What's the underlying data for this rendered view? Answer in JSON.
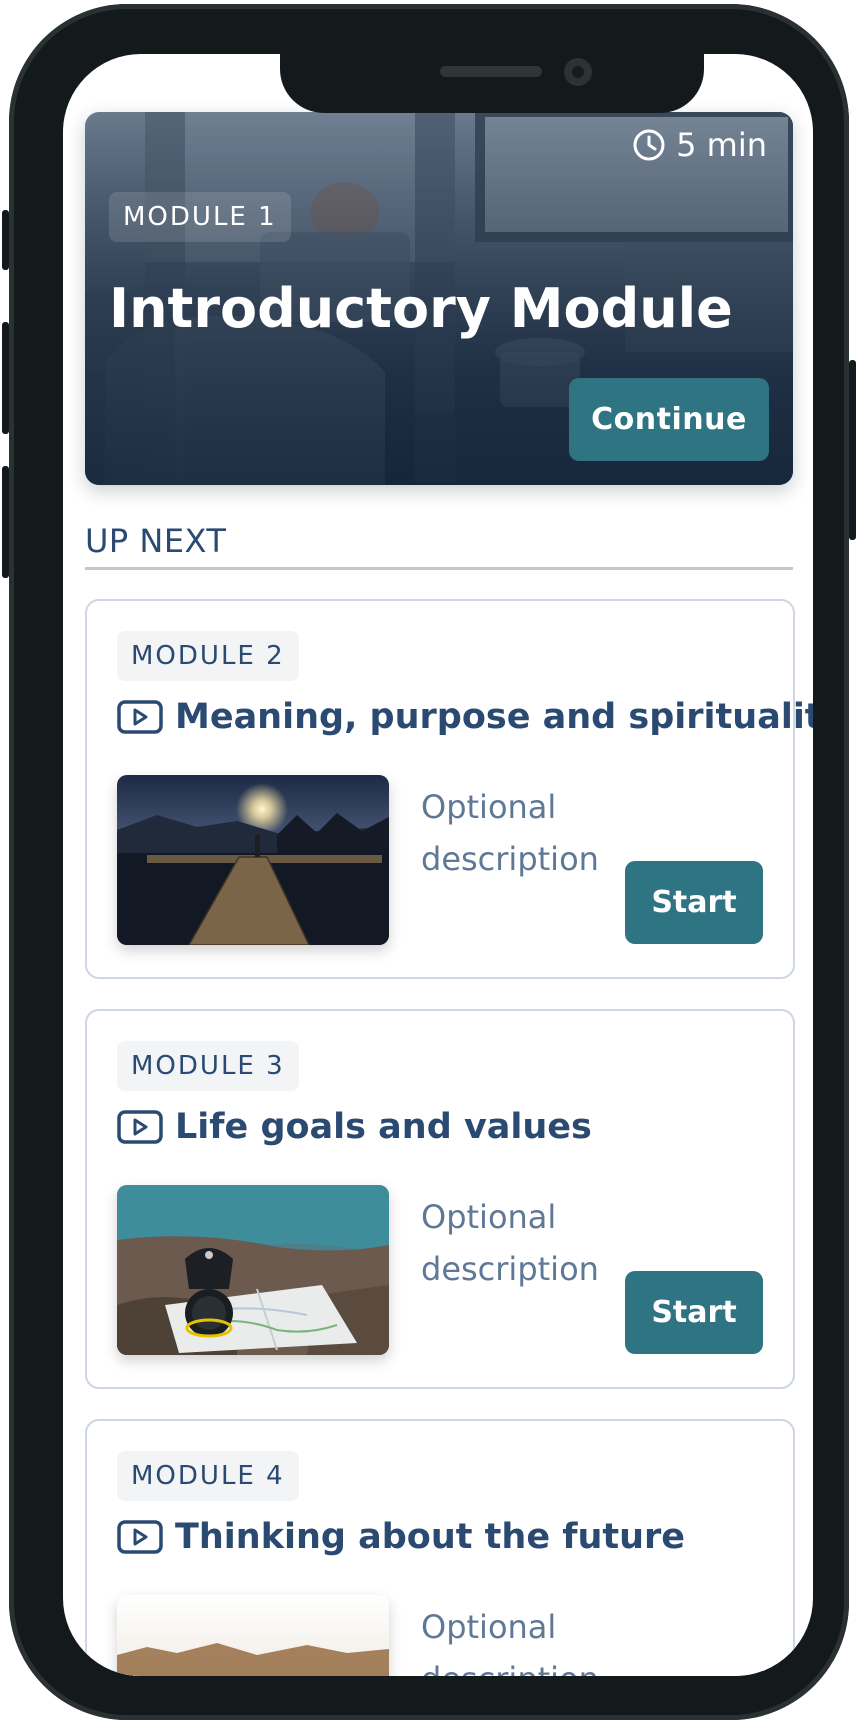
{
  "hero": {
    "duration": "5 min",
    "module_label": "MODULE 1",
    "title": "Introductory Module",
    "cta_label": "Continue"
  },
  "up_next": {
    "heading": "UP NEXT"
  },
  "modules": [
    {
      "module_label": "MODULE 2",
      "title": "Meaning, purpose and spirituality",
      "description": "Optional description",
      "cta_label": "Start"
    },
    {
      "module_label": "MODULE 3",
      "title": "Life goals and values",
      "description": "Optional description",
      "cta_label": "Start"
    },
    {
      "module_label": "MODULE 4",
      "title": "Thinking about the future",
      "description": "Optional description"
    }
  ],
  "icons": {
    "duration": "clock-icon",
    "module_type": "video-play-icon"
  },
  "colors": {
    "accent": "#2f7483",
    "heading": "#2b4a72",
    "muted_text": "#5f7896",
    "card_border": "#cdd6e3"
  }
}
